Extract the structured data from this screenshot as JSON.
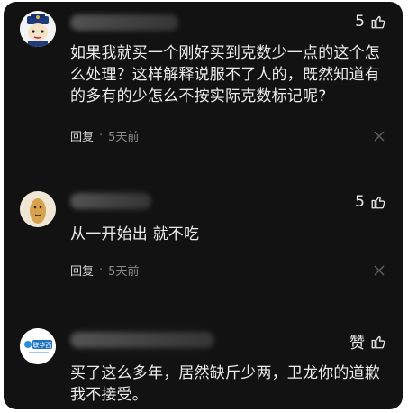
{
  "comments": [
    {
      "likes": "5",
      "text": "如果我就买一个刚好买到克数少一点的这个怎么处理？这样解释说服不了人的，既然知道有的多有的少怎么不按实际克数标记呢?",
      "reply_label": "回复",
      "separator": "·",
      "time": "5天前"
    },
    {
      "likes": "5",
      "text": "从一开始出 就不吃",
      "reply_label": "回复",
      "separator": "·",
      "time": "5天前"
    },
    {
      "likes": "赞",
      "text": "买了这么多年，居然缺斤少两，卫龙你的道歉我不接受。",
      "avatar_logo_text": "联华西"
    }
  ],
  "icons": {
    "like": "thumbs-up-icon",
    "close": "close-icon"
  },
  "colors": {
    "background": "#121212",
    "text": "#ececec",
    "meta": "#8c8c8c"
  }
}
